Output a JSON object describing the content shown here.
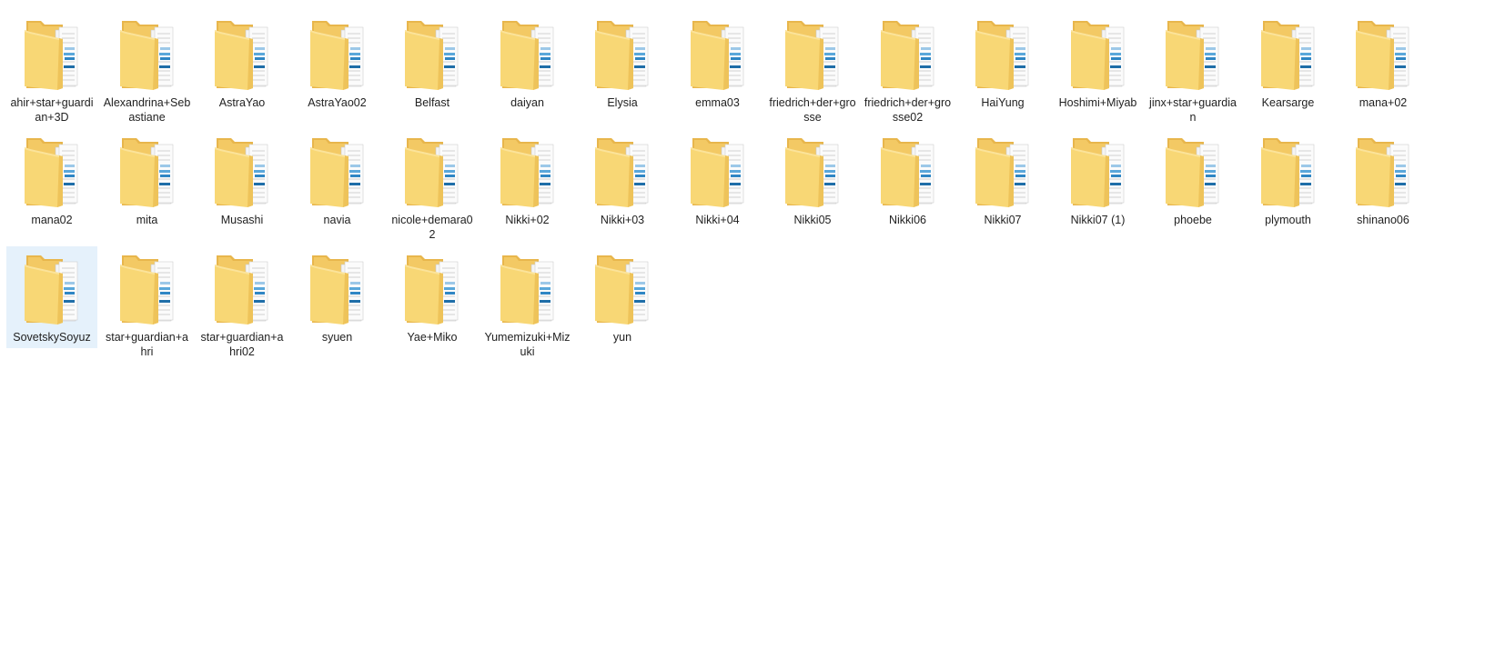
{
  "folders": [
    {
      "name": "ahir+star+guardian+3D"
    },
    {
      "name": "Alexandrina+Sebastiane"
    },
    {
      "name": "AstraYao"
    },
    {
      "name": "AstraYao02"
    },
    {
      "name": "Belfast"
    },
    {
      "name": "daiyan"
    },
    {
      "name": "Elysia"
    },
    {
      "name": "emma03"
    },
    {
      "name": "friedrich+der+grosse"
    },
    {
      "name": "friedrich+der+grosse02"
    },
    {
      "name": "HaiYung"
    },
    {
      "name": "Hoshimi+Miyab"
    },
    {
      "name": "jinx+star+guardian"
    },
    {
      "name": "Kearsarge"
    },
    {
      "name": "mana+02"
    },
    {
      "name": "mana02"
    },
    {
      "name": "mita"
    },
    {
      "name": "Musashi"
    },
    {
      "name": "navia"
    },
    {
      "name": "nicole+demara02"
    },
    {
      "name": "Nikki+02"
    },
    {
      "name": "Nikki+03"
    },
    {
      "name": "Nikki+04"
    },
    {
      "name": "Nikki05"
    },
    {
      "name": "Nikki06"
    },
    {
      "name": "Nikki07"
    },
    {
      "name": "Nikki07 (1)"
    },
    {
      "name": "phoebe"
    },
    {
      "name": "plymouth"
    },
    {
      "name": "shinano06"
    },
    {
      "name": "SovetskySoyuz",
      "selected": true
    },
    {
      "name": "star+guardian+ahri"
    },
    {
      "name": "star+guardian+ahri02"
    },
    {
      "name": "syuen"
    },
    {
      "name": "Yae+Miko"
    },
    {
      "name": "Yumemizuki+Mizuki"
    },
    {
      "name": "yun"
    }
  ],
  "colors": {
    "folder_back": "#e8b64c",
    "folder_front": "#f8d775",
    "selection": "#e5f1fb"
  }
}
